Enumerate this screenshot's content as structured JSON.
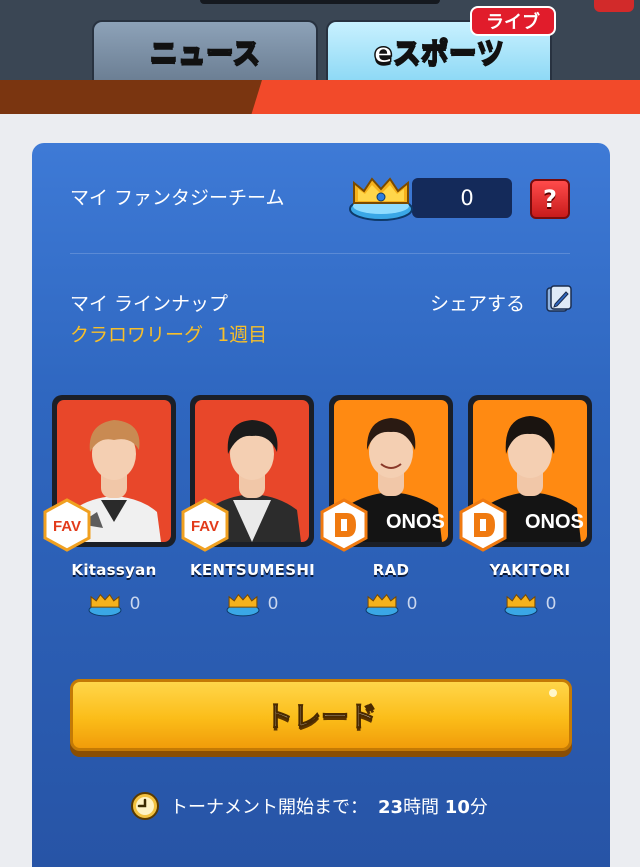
{
  "header": {
    "tabs": [
      {
        "label": "ニュース",
        "active": false
      },
      {
        "label": "eスポーツ",
        "active": true
      }
    ],
    "live_badge": "ライブ"
  },
  "fantasy": {
    "label": "マイ ファンタジーチーム",
    "score": "0",
    "help_label": "?"
  },
  "lineup": {
    "label": "マイ ラインナップ",
    "league": "クラロワリーグ",
    "week_num": "1",
    "week_suffix": "週目",
    "share_label": "シェアする"
  },
  "players": [
    {
      "name": "Kitassyan",
      "score": "0",
      "team": "FAV",
      "bg": "#e8472a"
    },
    {
      "name": "KENTSUMESHI",
      "score": "0",
      "team": "FAV",
      "bg": "#e8472a"
    },
    {
      "name": "RAD",
      "score": "0",
      "team": "D",
      "bg": "#ff8a12"
    },
    {
      "name": "YAKITORI",
      "score": "0",
      "team": "D",
      "bg": "#ff8a12"
    }
  ],
  "trade": {
    "label": "トレード"
  },
  "countdown": {
    "prefix": "トーナメント開始まで：",
    "hours": "23",
    "hours_unit": "時間",
    "minutes": "10",
    "minutes_unit": "分"
  },
  "colors": {
    "accent_gold": "#f7bf2a",
    "card_blue": "#2f67c0",
    "live_red": "#e11c2b"
  }
}
